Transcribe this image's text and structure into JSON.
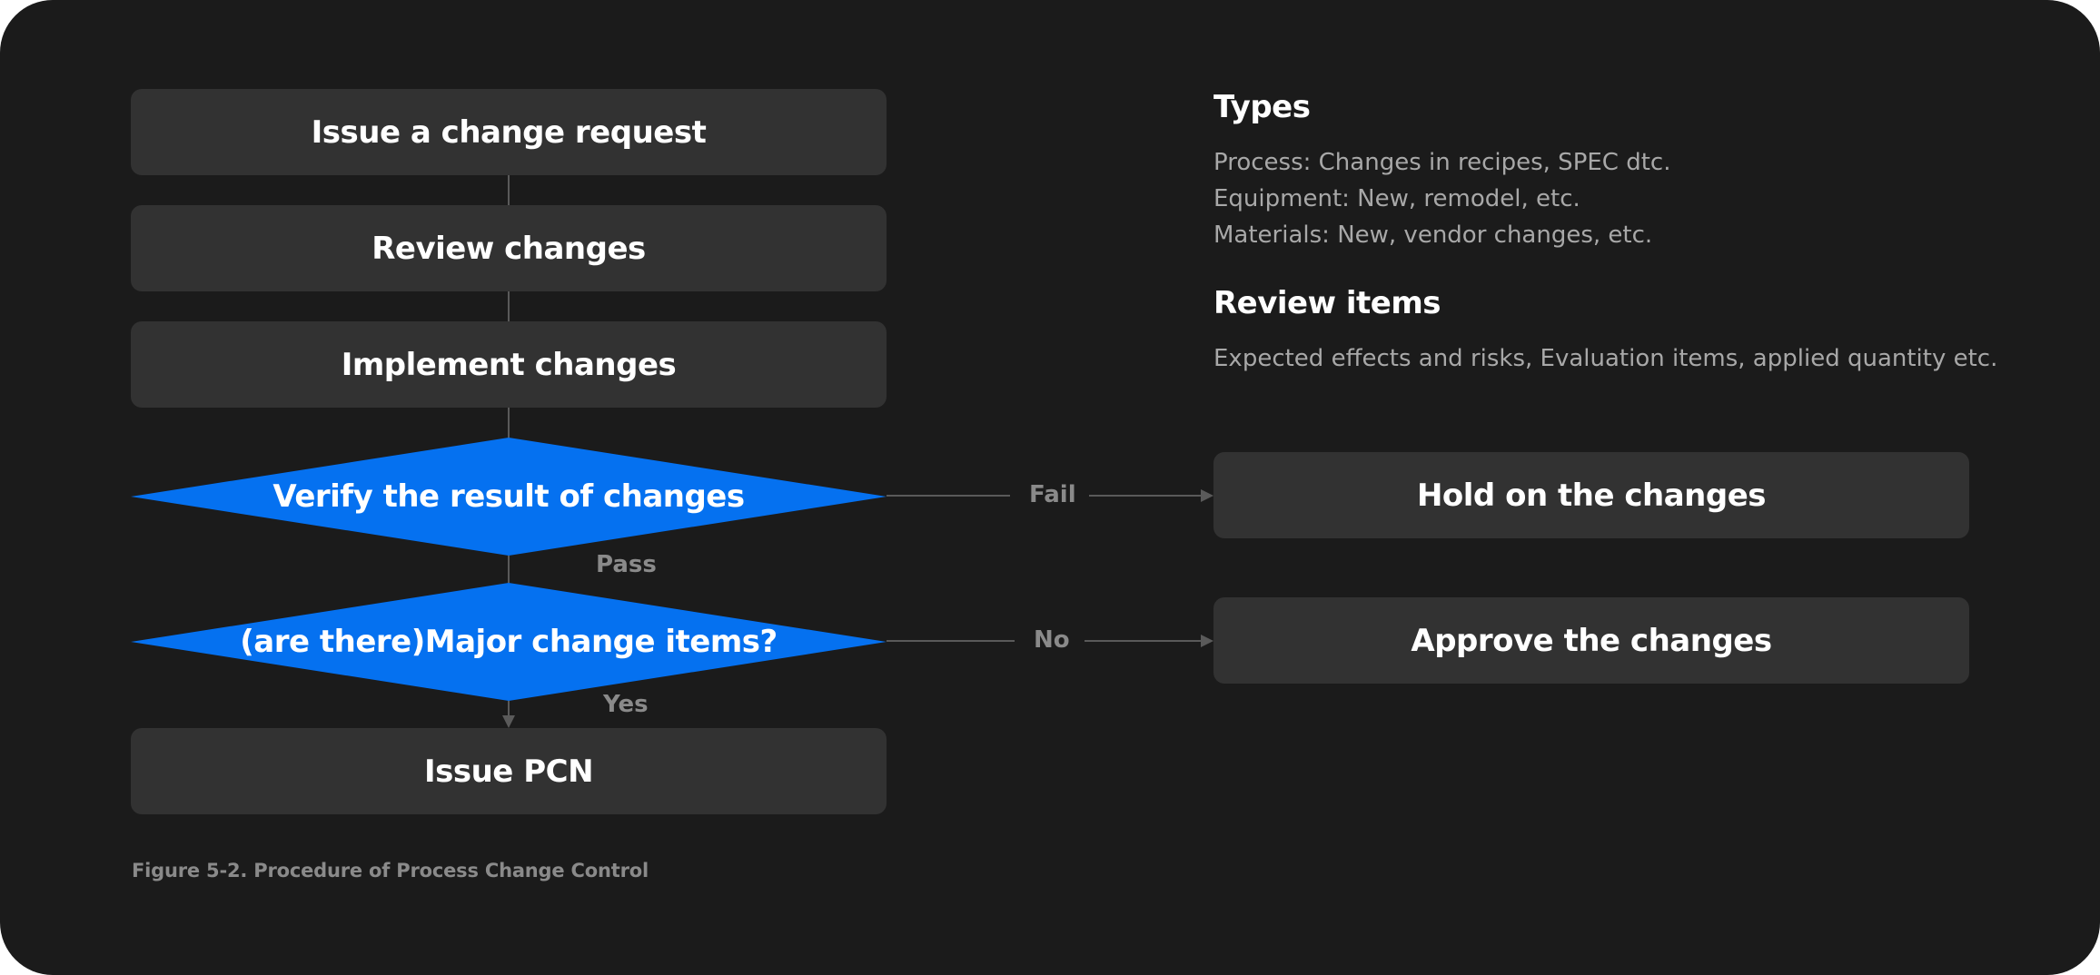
{
  "colors": {
    "background": "#1b1b1b",
    "box": "#323232",
    "decision": "#0571f0",
    "connector": "#5a5a5a",
    "text_primary": "#ffffff",
    "text_secondary": "#a8a8a8",
    "text_muted": "#8a8a8a"
  },
  "flow": {
    "issue_request": "Issue a change request",
    "review_changes": "Review changes",
    "implement_changes": "Implement changes",
    "verify_result": "Verify the result of changes",
    "major_items": "(are there)Major change items?",
    "issue_pcn": "Issue PCN",
    "hold_changes": "Hold on the changes",
    "approve_changes": "Approve the changes"
  },
  "edges": {
    "fail": "Fail",
    "pass": "Pass",
    "no": "No",
    "yes": "Yes"
  },
  "notes": {
    "types_title": "Types",
    "types_lines": [
      "Process: Changes in recipes, SPEC dtc.",
      "Equipment: New, remodel, etc.",
      "Materials: New, vendor changes, etc."
    ],
    "review_title": "Review items",
    "review_lines": [
      "Expected effects and risks, Evaluation items, applied quantity etc."
    ]
  },
  "caption": "Figure 5-2. Procedure of Process Change Control"
}
